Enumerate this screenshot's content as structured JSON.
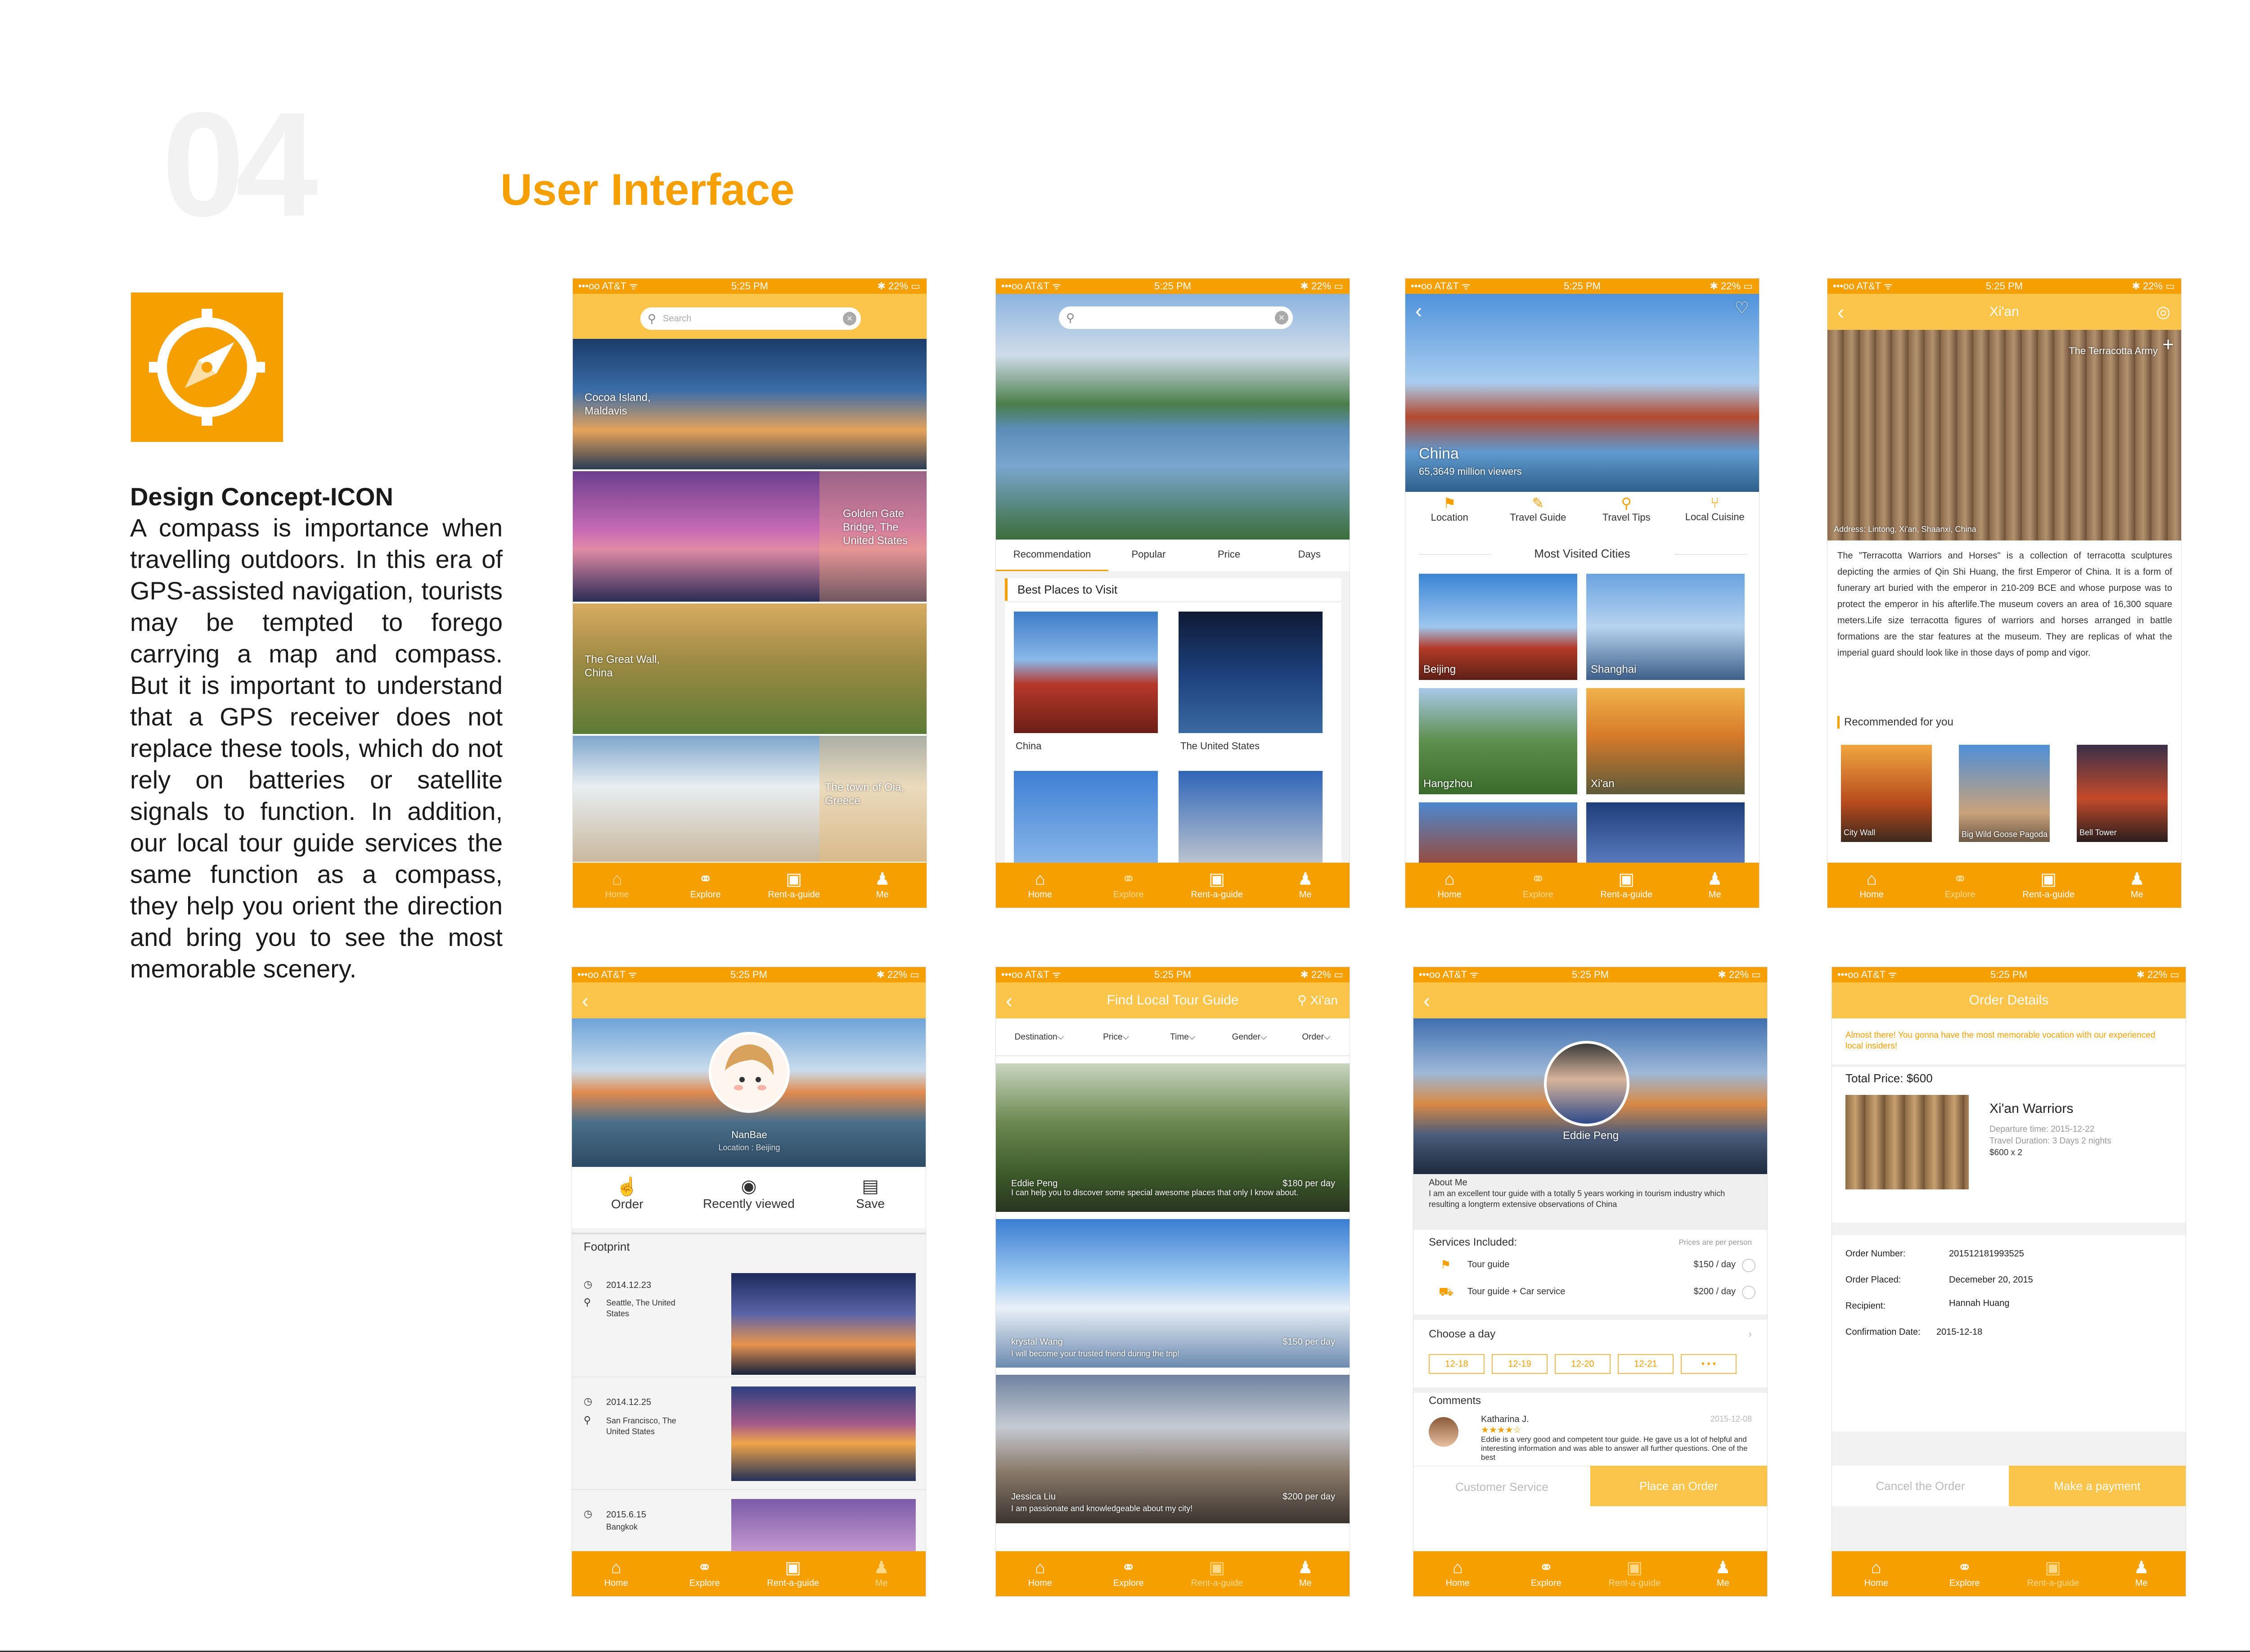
{
  "page": {
    "number_mark": "04",
    "title": "User Interface"
  },
  "concept": {
    "heading": "Design Concept-ICON",
    "body": "A compass is importance when travelling outdoors. In this era of GPS-assisted navigation, tourists may be tempted to forego carrying a map and compass. But it is important to understand that a GPS receiver does not replace these tools, which do not rely on batteries or satellite signals to function. In addition, our local tour guide services the same function as a compass, they help you orient the direction and bring you to see the most memorable scenery."
  },
  "status": {
    "carrier": "•••oo AT&T ᯤ",
    "time": "5:25 PM",
    "battery": "✱ 22% ▭"
  },
  "tabs": [
    "Home",
    "Explore",
    "Rent-a-guide",
    "Me"
  ],
  "colors": {
    "accent": "#f5a000",
    "accent_light": "#fbc54c"
  },
  "s1": {
    "search_placeholder": "Search",
    "cards": [
      "Cocoa Island, Maldavis",
      "Golden Gate Bridge, The United States",
      "The Great Wall, China",
      "The town of Oia, Greece"
    ]
  },
  "s2": {
    "tabs": [
      "Recommendation",
      "Popular",
      "Price",
      "Days"
    ],
    "section": "Best Places to Visit",
    "places": [
      "China",
      "The United States"
    ]
  },
  "s3": {
    "hero_title": "China",
    "hero_sub": "65,3649 million viewers",
    "menu": [
      "Location",
      "Travel Guide",
      "Travel Tips",
      "Local Cuisine"
    ],
    "section": "Most Visited Cities",
    "cities": [
      "Beijing",
      "Shanghai",
      "Hangzhou",
      "Xi'an"
    ]
  },
  "s4": {
    "title": "Xi'an",
    "hero_label": "The Terracotta Army",
    "address": "Address: Lintong, Xi'an, Shaanxi, China",
    "body": "The \"Terracotta Warriors and Horses\" is a collection of terracotta sculptures depicting the armies of Qin Shi Huang, the first Emperor of China. It is a form of funerary art buried with the emperor in 210-209 BCE and whose purpose was to protect the emperor in his afterlife.The museum covers an area of 16,300 square meters.Life size terracotta figures of warriors and horses arranged in battle formations are the star features at the museum. They are replicas of what the imperial guard should look like in those days of pomp and vigor.",
    "section": "Recommended for you",
    "recs": [
      "City Wall",
      "Big Wild Goose Pagoda",
      "Bell Tower"
    ]
  },
  "s5": {
    "name": "NanBae",
    "location": "Location : Beijing",
    "actions": [
      "Order",
      "Recently viewed",
      "Save"
    ],
    "section": "Footprint",
    "footprints": [
      {
        "date": "2014.12.23",
        "place": "Seattle, The United States"
      },
      {
        "date": "2014.12.25",
        "place": "San Francisco, The United States"
      },
      {
        "date": "2015.6.15",
        "place": "Bangkok"
      }
    ]
  },
  "s6": {
    "title": "Find Local Tour Guide",
    "location": "Xi'an",
    "filters": [
      "Destination",
      "Price",
      "Time",
      "Gender",
      "Order"
    ],
    "guides": [
      {
        "name": "Eddie Peng",
        "price": "$180 per day",
        "desc": "I can help you to discover some special awesome places that only I know about."
      },
      {
        "name": "krystal Wang",
        "price": "$150 per day",
        "desc": "I will become your trusted friend during the trip!"
      },
      {
        "name": "Jessica Liu",
        "price": "$200 per day",
        "desc": "I am passionate and knowledgeable about my city!"
      }
    ]
  },
  "s7": {
    "name": "Eddie Peng",
    "about_title": "About Me",
    "about": "I am an excellent tour guide with a totally 5 years working in tourism industry which resulting a longterm extensive observations of China",
    "services_title": "Services Included:",
    "prices_note": "Prices are per person",
    "services": [
      {
        "name": "Tour guide",
        "price": "$150 / day"
      },
      {
        "name": "Tour guide + Car service",
        "price": "$200 / day"
      }
    ],
    "choose": "Choose a day",
    "days": [
      "12-18",
      "12-19",
      "12-20",
      "12-21",
      "• • •"
    ],
    "comments_title": "Comments",
    "comment": {
      "author": "Katharina J.",
      "date": "2015-12-08",
      "stars": "★★★★☆",
      "text": "Eddie is a very good and competent tour guide. He gave us a lot of helpful and interesting information and was able to answer all further questions. One of the best"
    },
    "btn_service": "Customer Service",
    "btn_order": "Place an Order"
  },
  "s8": {
    "title": "Order Details",
    "notice": "Almost there! You gonna have the most memorable vocation with our experienced local insiders!",
    "total": "Total Price: $600",
    "product": "Xi'an Warriors",
    "departure": "Departure time:  2015-12-22",
    "duration": "Travel Duration:  3 Days 2 nights",
    "qty": "$600 x 2",
    "fields": [
      {
        "label": "Order Number:",
        "value": "201512181993525"
      },
      {
        "label": "Order Placed:",
        "value": "Decemeber 20, 2015"
      },
      {
        "label": "Recipient:",
        "value": "Hannah Huang"
      },
      {
        "label": "Confirmation Date:",
        "value": "2015-12-18"
      }
    ],
    "btn_cancel": "Cancel the Order",
    "btn_pay": "Make a payment"
  }
}
